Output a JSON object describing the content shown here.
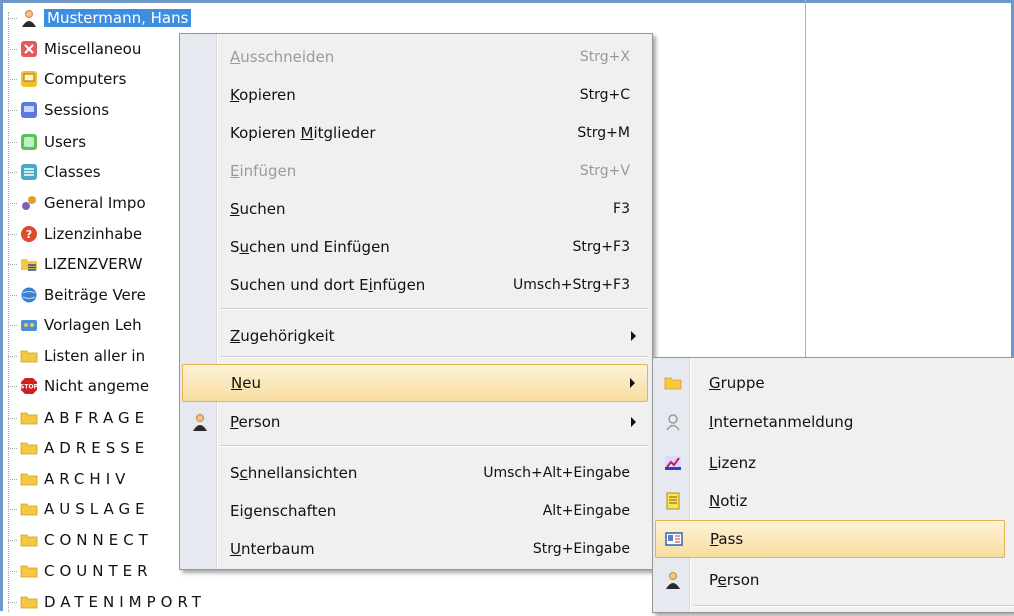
{
  "tree": {
    "items": [
      {
        "label": "Mustermann, Hans",
        "icon": "person-icon",
        "spaced": false,
        "selected": true
      },
      {
        "label": "Miscellaneou",
        "icon": "miscellaneous-icon",
        "spaced": false
      },
      {
        "label": "Computers",
        "icon": "computers-icon",
        "spaced": false
      },
      {
        "label": "Sessions",
        "icon": "sessions-icon",
        "spaced": false
      },
      {
        "label": "Users",
        "icon": "users-icon",
        "spaced": false
      },
      {
        "label": "Classes",
        "icon": "classes-icon",
        "spaced": false
      },
      {
        "label": "General Impo",
        "icon": "general-import-icon",
        "spaced": false
      },
      {
        "label": "Lizenzinhabe",
        "icon": "help-icon",
        "spaced": false
      },
      {
        "label": "LIZENZVERW",
        "icon": "folder-list-icon",
        "spaced": false
      },
      {
        "label": "Beiträge Vere",
        "icon": "globe-icon",
        "spaced": false
      },
      {
        "label": "Vorlagen Leh",
        "icon": "templates-icon",
        "spaced": false
      },
      {
        "label": "Listen aller in",
        "icon": "folder-icon",
        "spaced": false
      },
      {
        "label": "Nicht angeme",
        "icon": "stop-icon",
        "spaced": false
      },
      {
        "label": "ABFRAGE",
        "icon": "folder-icon",
        "spaced": true
      },
      {
        "label": "ADRESSE",
        "icon": "folder-icon",
        "spaced": true
      },
      {
        "label": "ARCHIV",
        "icon": "folder-icon",
        "spaced": true
      },
      {
        "label": "AUSLAGE",
        "icon": "folder-icon",
        "spaced": true
      },
      {
        "label": "CONNECT",
        "icon": "folder-icon",
        "spaced": true
      },
      {
        "label": "COUNTER",
        "icon": "folder-icon",
        "spaced": true
      },
      {
        "label": "DATENIMPORT",
        "icon": "folder-icon",
        "spaced": true
      }
    ]
  },
  "context_menu": {
    "items": [
      {
        "pre": "",
        "u": "A",
        "post": "usschneiden",
        "shortcut": "Strg+X",
        "disabled": true
      },
      {
        "pre": "",
        "u": "K",
        "post": "opieren",
        "shortcut": "Strg+C",
        "disabled": false
      },
      {
        "pre": "Kopieren ",
        "u": "M",
        "post": "itglieder",
        "shortcut": "Strg+M",
        "disabled": false
      },
      {
        "pre": "",
        "u": "E",
        "post": "infügen",
        "shortcut": "Strg+V",
        "disabled": true
      },
      {
        "pre": "",
        "u": "S",
        "post": "uchen",
        "shortcut": "F3",
        "disabled": false
      },
      {
        "pre": "S",
        "u": "u",
        "post": "chen und Einfügen",
        "shortcut": "Strg+F3",
        "disabled": false
      },
      {
        "pre": "Suchen und dort E",
        "u": "i",
        "post": "nfügen",
        "shortcut": "Umsch+Strg+F3",
        "disabled": false
      },
      {
        "pre": "",
        "u": "Z",
        "post": "ugehörigkeit",
        "submenu": true
      },
      {
        "pre": "",
        "u": "N",
        "post": "eu",
        "submenu": true,
        "highlighted": true
      },
      {
        "pre": "",
        "u": "P",
        "post": "erson",
        "submenu": true,
        "icon": "person-icon"
      },
      {
        "pre": "S",
        "u": "c",
        "post": "hnellansichten",
        "shortcut": "Umsch+Alt+Eingabe",
        "disabled": false
      },
      {
        "pre": "Ei",
        "u": "g",
        "post": "enschaften",
        "shortcut": "Alt+Eingabe",
        "disabled": false
      },
      {
        "pre": "",
        "u": "U",
        "post": "nterbaum",
        "shortcut": "Strg+Eingabe",
        "disabled": false
      }
    ]
  },
  "submenu_neu": {
    "items": [
      {
        "pre": "",
        "u": "G",
        "post": "ruppe",
        "icon": "folder-icon"
      },
      {
        "pre": "",
        "u": "I",
        "post": "nternetanmeldung",
        "icon": "internet-login-icon"
      },
      {
        "pre": "",
        "u": "L",
        "post": "izenz",
        "icon": "license-icon"
      },
      {
        "pre": "",
        "u": "N",
        "post": "otiz",
        "icon": "note-icon"
      },
      {
        "pre": "",
        "u": "P",
        "post": "ass",
        "icon": "pass-icon",
        "highlighted": true
      },
      {
        "pre": "P",
        "u": "e",
        "post": "rson",
        "icon": "person-icon"
      }
    ]
  },
  "colors": {
    "selection": "#3d8ee0",
    "highlight_border": "#e5b44f",
    "menu_bg": "#f0f0f0"
  }
}
